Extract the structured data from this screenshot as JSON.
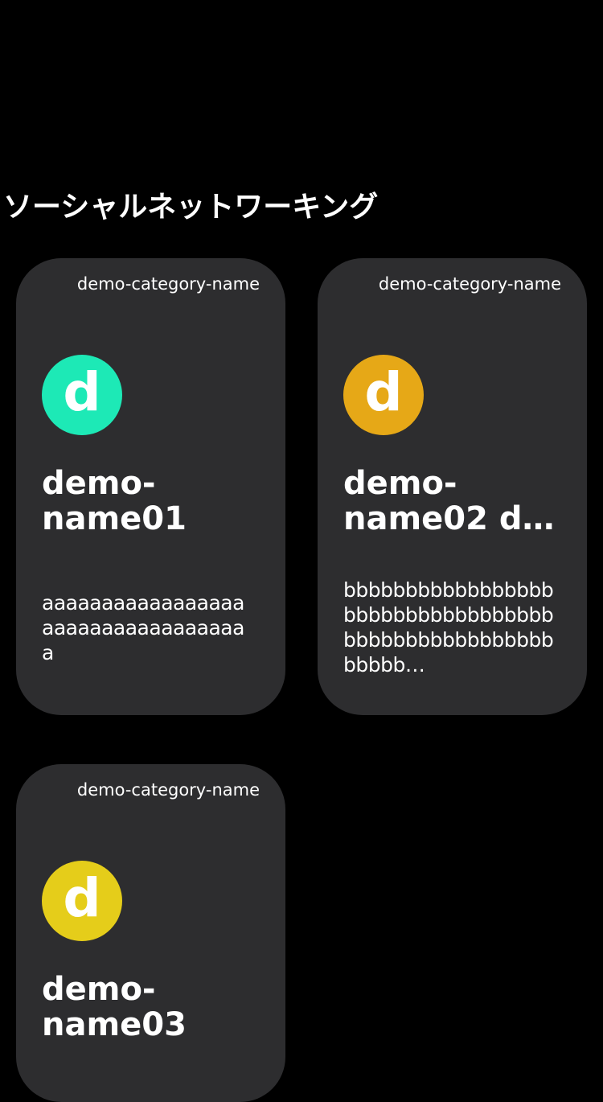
{
  "section": {
    "title": "ソーシャルネットワーキング"
  },
  "cards": [
    {
      "category": "demo-category-name",
      "avatar_letter": "d",
      "avatar_color": "#1de9b6",
      "name": "demo-name01",
      "description": "aaaaaaaaaaaaaaaaaaaaaaaaaaaaaaaaaaa"
    },
    {
      "category": "demo-category-name",
      "avatar_letter": "d",
      "avatar_color": "#e6a817",
      "name": "demo-name02 d…",
      "description": "bbbbbbbbbbbbbbbbbbbbbbbbbbbbbbbbbbbbbbbbbbbbbbbbbbbbbbbb…"
    },
    {
      "category": "demo-category-name",
      "avatar_letter": "d",
      "avatar_color": "#e5cd1a",
      "name": "demo-name03",
      "description": ""
    }
  ]
}
